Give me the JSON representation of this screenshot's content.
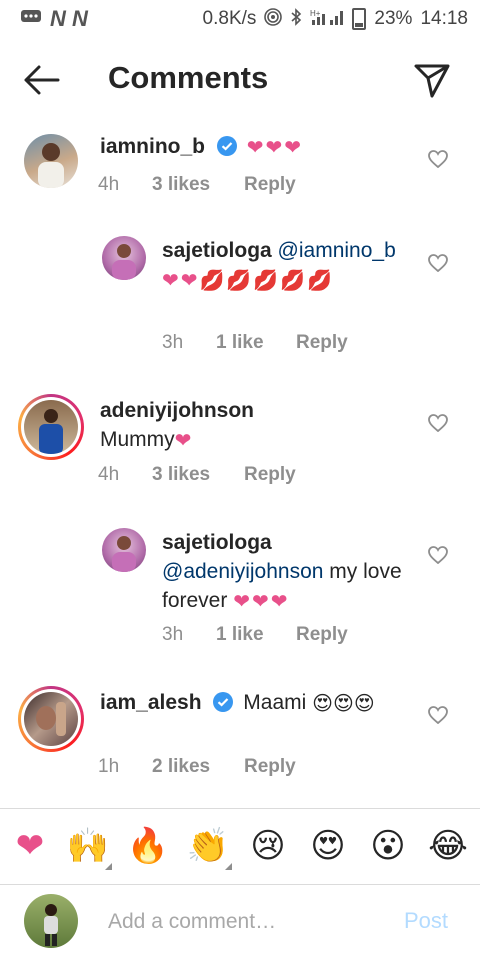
{
  "status_bar": {
    "speed": "0.8K/s",
    "battery": "23%",
    "time": "14:18",
    "network_letters": "N N",
    "signal_tag": "H+"
  },
  "header": {
    "title": "Comments"
  },
  "comments": [
    {
      "username": "iamnino_b",
      "verified": true,
      "text": "",
      "emojis": "❤❤❤",
      "time": "4h",
      "likes": "3 likes",
      "reply": "Reply"
    },
    {
      "username": "sajetiologa",
      "mention": "@iamnino_b",
      "text": "",
      "emojis": "❤❤💋💋💋💋💋",
      "time": "3h",
      "likes": "1 like",
      "reply": "Reply"
    },
    {
      "username": "adeniyijohnson",
      "text": "Mummy",
      "emojis": "❤",
      "time": "4h",
      "likes": "3 likes",
      "reply": "Reply"
    },
    {
      "username": "sajetiologa",
      "mention": "@adeniyijohnson",
      "text": " my love forever ",
      "emojis": "❤❤❤",
      "time": "3h",
      "likes": "1 like",
      "reply": "Reply"
    },
    {
      "username": "iam_alesh",
      "verified": true,
      "text": "Maami ",
      "emojis": "😍😍😍",
      "time": "1h",
      "likes": "2 likes",
      "reply": "Reply"
    }
  ],
  "emoji_bar": [
    "❤",
    "🙌",
    "🔥",
    "👏",
    "😢",
    "😍",
    "😮",
    "😂"
  ],
  "composer": {
    "placeholder": "Add a comment…",
    "post_label": "Post"
  },
  "colors": {
    "pink_heart": "#e8508a",
    "mention": "#00376b",
    "verified_blue": "#3897f0",
    "post_disabled": "#b3dbff"
  }
}
